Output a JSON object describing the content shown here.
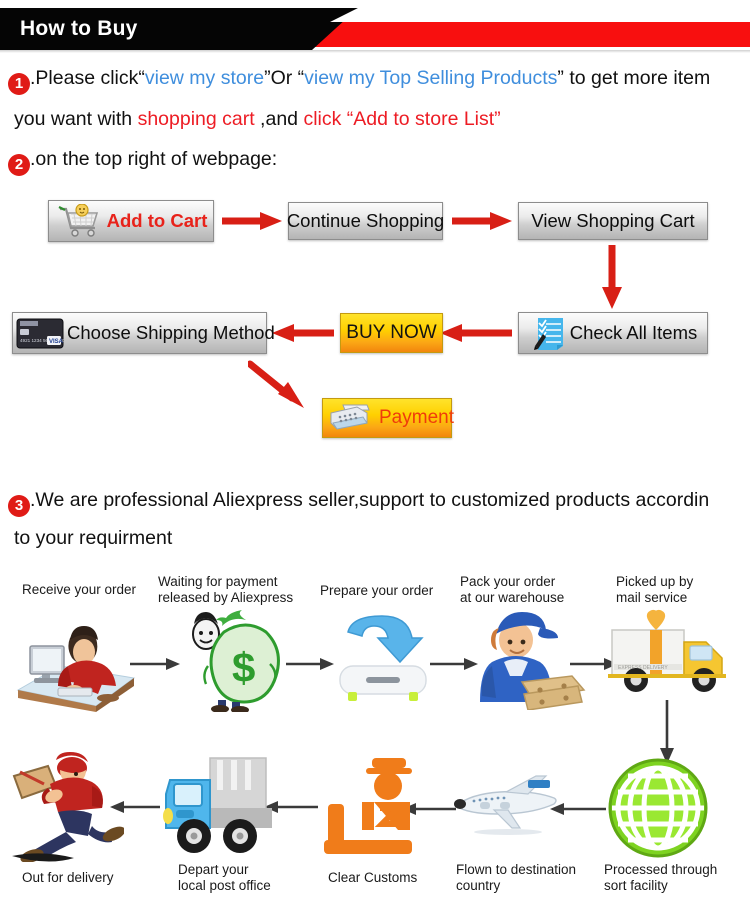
{
  "header": {
    "title": "How to Buy",
    "black": "#050505",
    "red": "#f80f0f"
  },
  "colors": {
    "link_blue": "#3f8edd",
    "accent_red": "#ed1c24",
    "badge_red": "#e01b16",
    "arrow_red": "#d81f15",
    "gold_top": "#ffe32b",
    "gold_bottom": "#f2860d"
  },
  "instructions": {
    "step1": {
      "badge": "1",
      "line1_a": ".Please click“",
      "line1_link1": "view my store",
      "line1_b": "”Or “",
      "line1_link2": "view my Top Selling Products",
      "line1_c": "” to get more item",
      "line2_a": "you want with ",
      "line2_red1": "shopping cart",
      "line2_b": " ,and ",
      "line2_red2": "click “Add to store List”"
    },
    "step2": {
      "badge": "2",
      "text": ".on the top right of webpage:"
    },
    "step3": {
      "badge": "3",
      "line1": ".We are professional Aliexpress seller,support to customized products accordin",
      "line2": "to your requirment"
    }
  },
  "flow_buttons": [
    {
      "id": "add-to-cart",
      "label": "Add to Cart",
      "icon": "shopping-cart-icon",
      "style": "silver-red"
    },
    {
      "id": "continue-shopping",
      "label": "Continue Shopping",
      "icon": "none",
      "style": "silver"
    },
    {
      "id": "view-shopping-cart",
      "label": "View Shopping Cart",
      "icon": "none",
      "style": "silver"
    },
    {
      "id": "check-all-items",
      "label": "Check All Items",
      "icon": "checklist-icon",
      "style": "silver"
    },
    {
      "id": "buy-now",
      "label": "BUY NOW",
      "icon": "none",
      "style": "gold"
    },
    {
      "id": "choose-shipping-method",
      "label": "Choose Shipping Method",
      "icon": "credit-card-icon",
      "style": "silver"
    },
    {
      "id": "payment",
      "label": "Payment",
      "icon": "cash-register-icon",
      "style": "gold"
    }
  ],
  "process_flow": {
    "row1": [
      {
        "label1": "Receive your order",
        "label2": "",
        "icon": "person-at-computer-icon"
      },
      {
        "label1": "Waiting for payment",
        "label2": "released by Aliexpress",
        "icon": "money-bag-icon"
      },
      {
        "label1": "Prepare your order",
        "label2": "",
        "icon": "blue-download-arrow-icon"
      },
      {
        "label1": "Pack your order",
        "label2": "at our warehouse",
        "icon": "warehouse-worker-icon"
      },
      {
        "label1": "Picked up by",
        "label2": "mail service",
        "icon": "delivery-truck-gift-icon"
      }
    ],
    "row2": [
      {
        "label1": "Out for delivery",
        "label2": "",
        "icon": "running-courier-icon"
      },
      {
        "label1": "Depart your",
        "label2": "local post office",
        "icon": "blue-truck-icon"
      },
      {
        "label1": "Clear Customs",
        "label2": "",
        "icon": "customs-officer-icon"
      },
      {
        "label1": "Flown to destination",
        "label2": "country",
        "icon": "airplane-icon"
      },
      {
        "label1": "Processed through",
        "label2": "sort facility",
        "icon": "green-globe-icon"
      }
    ]
  }
}
